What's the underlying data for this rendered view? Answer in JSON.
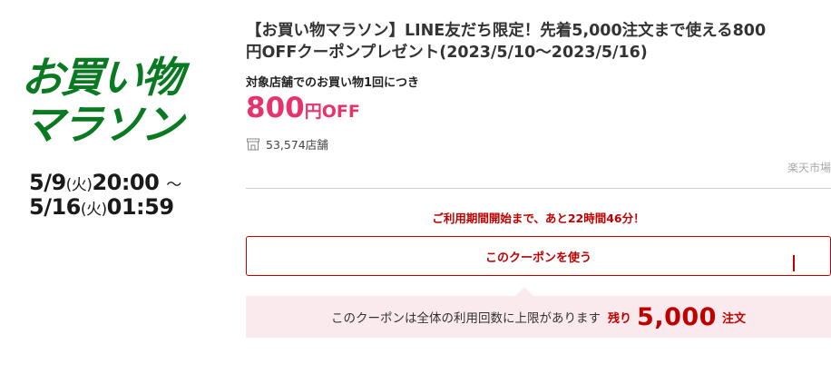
{
  "banner": {
    "title_line1": "お買い物",
    "title_line2": "マラソン",
    "start": {
      "date": "5/9",
      "weekday": "(火)",
      "time": "20:00",
      "sep": "～"
    },
    "end": {
      "date": "5/16",
      "weekday": "(火)",
      "time": "01:59"
    },
    "title_color": "#0a7a22"
  },
  "coupon": {
    "title_line1": "【お買い物マラソン】LINE友だち限定！先着5,000注文まで使える800",
    "title_line2": "円OFFクーポンプレゼント(2023/5/10～2023/5/16)",
    "condition": "対象店舗でのお買い物1回につき",
    "discount_amount": "800",
    "discount_yen": "円",
    "discount_off": "OFF",
    "shop_count": "53,574店舗",
    "issuer": "楽天市場",
    "countdown": "ご利用期間開始まで、あと22時間46分！",
    "use_button": "このクーポンを使う",
    "limit_message": "このクーポンは全体の利用回数に上限があります",
    "remaining_label": "残り",
    "remaining_count": "5,000",
    "remaining_unit": "注文"
  },
  "colors": {
    "accent": "#bf0000",
    "discount": "#e5336b",
    "notice_bg": "#fbeaed"
  },
  "icons": {
    "store": "store-icon"
  }
}
